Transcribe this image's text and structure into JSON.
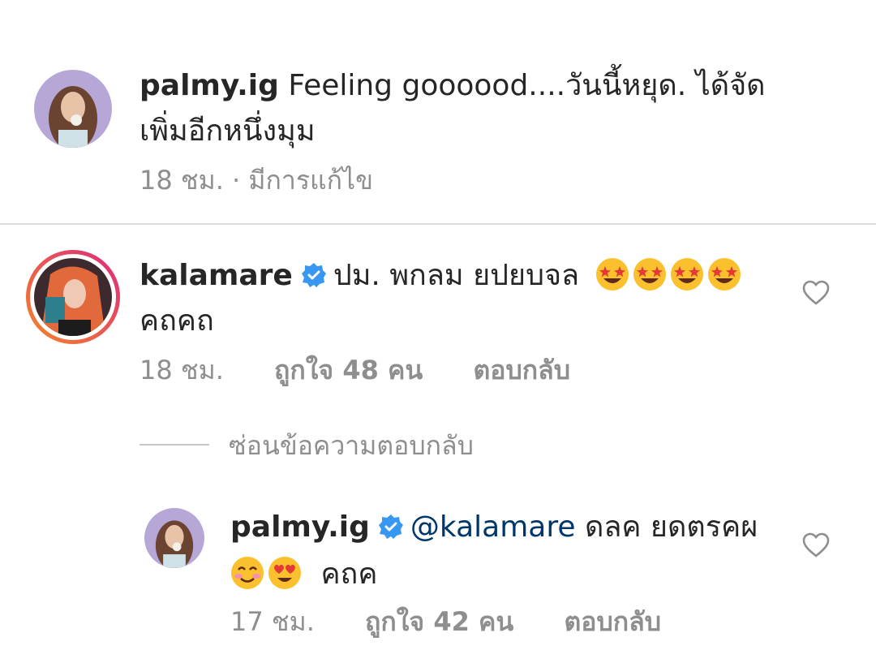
{
  "caption": {
    "username": "palmy.ig",
    "text_line1": "Feeling goooood....วันนี้หยุด. ได้จัด",
    "text_line2": "เพิ่มอีกหนึ่งมุม",
    "time": "18 ชม.",
    "separator": "·",
    "edited": "มีการแก้ไข"
  },
  "comment": {
    "username": "kalamare",
    "text_line1": "ปม. พกลม ยปยบจล",
    "text_line2": "คถคถ",
    "emojis": [
      "star-struck-emoji",
      "star-struck-emoji",
      "star-struck-emoji",
      "star-struck-emoji"
    ],
    "time": "18 ชม.",
    "likes": "ถูกใจ 48 คน",
    "reply": "ตอบกลับ",
    "hide_replies": "ซ่อนข้อความตอบกลับ"
  },
  "reply": {
    "username": "palmy.ig",
    "mention": "@kalamare",
    "text_line1": "ดลค ยดตรคผ",
    "text_line2": "คถค",
    "emojis": [
      "smiling-emoji",
      "heart-eyes-emoji"
    ],
    "time": "17 ชม.",
    "likes": "ถูกใจ 42 คน",
    "reply": "ตอบกลับ"
  },
  "colors": {
    "verified": "#3897f0",
    "muted": "#8e8e8e",
    "mention": "#00376b",
    "story_ring_start": "#f58529",
    "story_ring_end": "#dd2a7b"
  }
}
